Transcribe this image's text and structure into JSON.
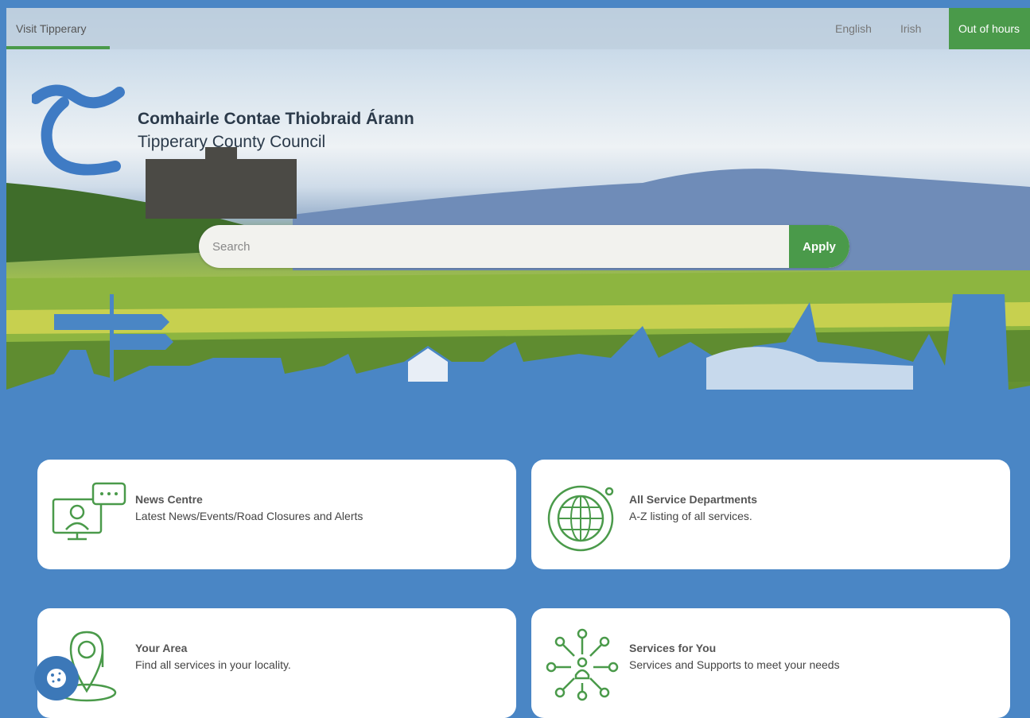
{
  "topbar": {
    "visit_label": "Visit Tipperary",
    "english_label": "English",
    "irish_label": "Irish",
    "out_of_hours_label": "Out of hours"
  },
  "brand": {
    "irish_name": "Comhairle Contae Thiobraid Árann",
    "english_name": "Tipperary County Council"
  },
  "search": {
    "placeholder": "Search",
    "apply_label": "Apply"
  },
  "cards": [
    {
      "title": "News Centre",
      "desc": "Latest News/Events/Road Closures and Alerts",
      "icon": "monitor-chat-icon"
    },
    {
      "title": "All Service Departments",
      "desc": "A-Z listing of all services.",
      "icon": "globe-icon"
    },
    {
      "title": "Your Area",
      "desc": "Find all services in your locality.",
      "icon": "map-pin-icon"
    },
    {
      "title": "Services for You",
      "desc": "Services and Supports to meet your needs",
      "icon": "network-person-icon"
    }
  ],
  "colors": {
    "brand_blue": "#4a86c5",
    "accent_green": "#4a9a4a"
  }
}
